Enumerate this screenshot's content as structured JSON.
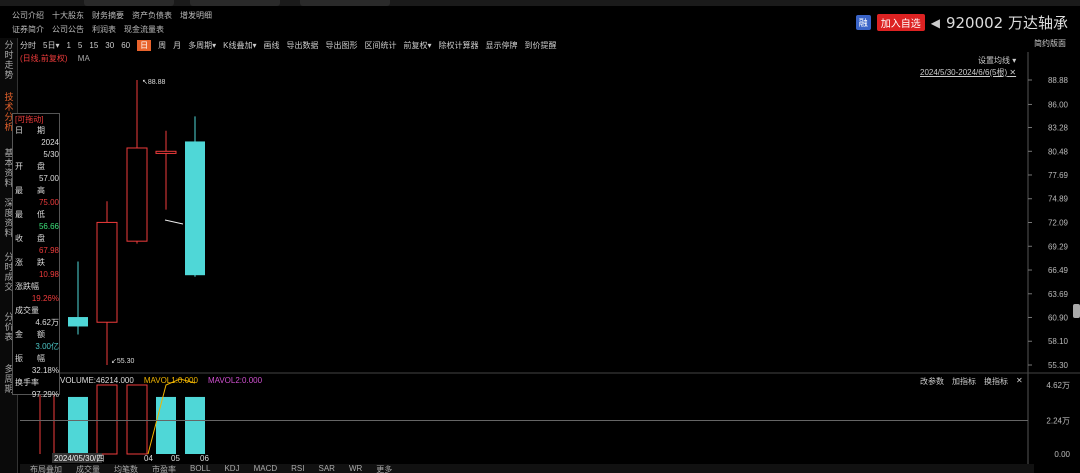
{
  "menu_row1": [
    "公司介绍",
    "十大股东",
    "财务摘要",
    "资产负债表",
    "增发明细"
  ],
  "menu_row2": [
    "证券简介",
    "公司公告",
    "利润表",
    "现金流量表"
  ],
  "header": {
    "rong_label": "融",
    "add_fav_label": "加入自选",
    "stock": "920002 万达轴承"
  },
  "left_nav": [
    {
      "label": "分时走势",
      "active": false
    },
    {
      "label": "技术分析",
      "active": true
    },
    {
      "label": "基本资料",
      "active": false
    },
    {
      "label": "深度资料",
      "active": false
    },
    {
      "label": "分时成交",
      "active": false
    },
    {
      "label": "分价表",
      "active": false
    },
    {
      "label": "多周期",
      "active": false
    }
  ],
  "toolbar": [
    "分时",
    "5日▾",
    "1",
    "5",
    "15",
    "30",
    "60",
    "日",
    "周",
    "月",
    "多周期▾",
    "K线叠加▾",
    "画线",
    "导出数据",
    "导出图形",
    "区间统计",
    "前复权▾",
    "除权计算器",
    "显示停牌",
    "到价提醒"
  ],
  "toolbar_active": "日",
  "right_panel": {
    "label": "简约版面"
  },
  "chart_header": {
    "subtitle": "(日线,前复权)",
    "ma_label": "MA",
    "set_ma": "设置均线",
    "range": "2024/5/30-2024/6/6(5根)"
  },
  "info_box": {
    "title": "[可拖动]",
    "rows": [
      {
        "label": "日",
        "label2": "期",
        "value": ""
      },
      {
        "label": "",
        "value": "2024",
        "color": "white"
      },
      {
        "label": "",
        "value": "5/30",
        "color": "white"
      },
      {
        "label": "开",
        "label2": "盘",
        "value": ""
      },
      {
        "label": "",
        "value": "57.00",
        "color": "white"
      },
      {
        "label": "最",
        "label2": "高",
        "value": ""
      },
      {
        "label": "",
        "value": "75.00",
        "color": "red"
      },
      {
        "label": "最",
        "label2": "低",
        "value": ""
      },
      {
        "label": "",
        "value": "56.66",
        "color": "green"
      },
      {
        "label": "收",
        "label2": "盘",
        "value": ""
      },
      {
        "label": "",
        "value": "67.98",
        "color": "red"
      },
      {
        "label": "涨",
        "label2": "跌",
        "value": ""
      },
      {
        "label": "",
        "value": "10.98",
        "color": "red"
      },
      {
        "label": "涨跌幅",
        "value": ""
      },
      {
        "label": "",
        "value": "19.26%",
        "color": "red"
      },
      {
        "label": "成交量",
        "value": ""
      },
      {
        "label": "",
        "value": "4.62万",
        "color": "white"
      },
      {
        "label": "金",
        "label2": "额",
        "value": ""
      },
      {
        "label": "",
        "value": "3.00亿",
        "color": "cyan"
      },
      {
        "label": "振",
        "label2": "幅",
        "value": ""
      },
      {
        "label": "",
        "value": "32.18%",
        "color": "white"
      },
      {
        "label": "换手率",
        "value": ""
      },
      {
        "label": "",
        "value": "97.29%",
        "color": "white"
      }
    ]
  },
  "vol_header": {
    "vol": "VOLUME:46214.000",
    "mavol1": "MAVOL1:0.000",
    "mavol2": "MAVOL2:0.000"
  },
  "vol_right": [
    "改参数",
    "加指标",
    "换指标"
  ],
  "bottom_tabs": [
    "布局叠加",
    "成交量",
    "均笔数",
    "市盈率",
    "BOLL",
    "KDJ",
    "MACD",
    "RSI",
    "SAR",
    "WR",
    "更多"
  ],
  "date_box": "2024/05/30/四",
  "x_labels": [
    "04",
    "05",
    "06"
  ],
  "colors": {
    "up": "#f03c3c",
    "down": "#4fd7d7",
    "accent": "#e8632c",
    "vol_ma": "#f0b400"
  },
  "chart_data": {
    "type": "candlestick",
    "y_ticks": [
      "88.88",
      "86.00",
      "83.28",
      "80.48",
      "77.69",
      "74.89",
      "72.09",
      "69.29",
      "66.49",
      "63.69",
      "60.90",
      "58.10",
      "55.30"
    ],
    "ylim": [
      55.3,
      88.88
    ],
    "candles": [
      {
        "open": 60.95,
        "close": 59.84,
        "high": 67.5,
        "low": 58.9,
        "dir": "down"
      },
      {
        "open": 60.34,
        "close": 72.1,
        "high": 74.6,
        "low": 55.3,
        "dir": "up"
      },
      {
        "open": 69.89,
        "close": 80.87,
        "high": 88.88,
        "low": 69.6,
        "dir": "up"
      },
      {
        "open": 80.48,
        "close": 80.23,
        "high": 82.9,
        "low": 73.6,
        "dir": "up"
      },
      {
        "open": 81.64,
        "close": 65.88,
        "high": 84.6,
        "low": 65.7,
        "dir": "down"
      }
    ],
    "high_label": "88.88",
    "low_label": "55.30",
    "volume": {
      "y_ticks": [
        "4.62万",
        "2.24万",
        "0.00"
      ],
      "ylim": [
        0,
        4.62
      ],
      "bars": [
        {
          "value": 0,
          "dir": "up"
        },
        {
          "value": 4.62,
          "dir": "down"
        },
        {
          "value": 4.62,
          "dir": "up"
        },
        {
          "value": 4.62,
          "dir": "up"
        },
        {
          "value": 4.62,
          "dir": "up"
        },
        {
          "value": 3.82,
          "dir": "down"
        },
        {
          "value": 3.82,
          "dir": "down"
        }
      ],
      "current_line": 2.24
    }
  }
}
